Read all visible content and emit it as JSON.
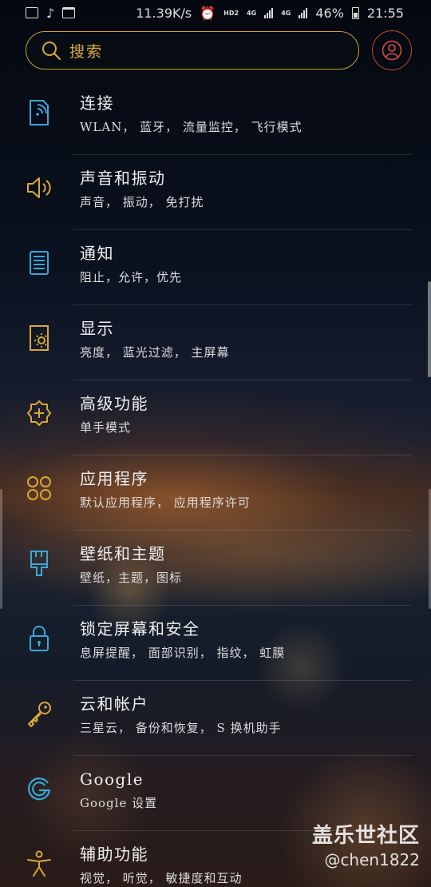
{
  "status_bar": {
    "speed": "11.39K/s",
    "hd": "HD2",
    "network1": "4G",
    "network2": "4G",
    "battery": "46%",
    "time": "21:55"
  },
  "search": {
    "placeholder": "搜索"
  },
  "settings": [
    {
      "title": "连接",
      "subtitle": "WLAN， 蓝牙， 流量监控， 飞行模式",
      "icon": "connection-icon"
    },
    {
      "title": "声音和振动",
      "subtitle": "声音， 振动， 免打扰",
      "icon": "sound-icon"
    },
    {
      "title": "通知",
      "subtitle": "阻止，允许，优先",
      "icon": "notification-icon"
    },
    {
      "title": "显示",
      "subtitle": "亮度， 蓝光过滤， 主屏幕",
      "icon": "display-icon"
    },
    {
      "title": "高级功能",
      "subtitle": "单手模式",
      "icon": "advanced-features-icon"
    },
    {
      "title": "应用程序",
      "subtitle": "默认应用程序， 应用程序许可",
      "icon": "apps-icon"
    },
    {
      "title": "壁纸和主题",
      "subtitle": "壁纸，主题，图标",
      "icon": "brush-icon"
    },
    {
      "title": "锁定屏幕和安全",
      "subtitle": "息屏提醒， 面部识别， 指纹， 虹膜",
      "icon": "lock-icon"
    },
    {
      "title": "云和帐户",
      "subtitle": "三星云， 备份和恢复， S 换机助手",
      "icon": "key-icon"
    },
    {
      "title": "Google",
      "subtitle": "Google 设置",
      "icon": "google-icon"
    },
    {
      "title": "辅助功能",
      "subtitle": "视觉， 听觉， 敏捷度和互动",
      "icon": "accessibility-icon"
    }
  ],
  "watermark": {
    "line1": "盖乐世社区",
    "line2": "@chen1822"
  },
  "colors": {
    "accent_blue": "#3aa7d8",
    "accent_gold": "#d9a83a",
    "accent_red": "#c4453f"
  }
}
